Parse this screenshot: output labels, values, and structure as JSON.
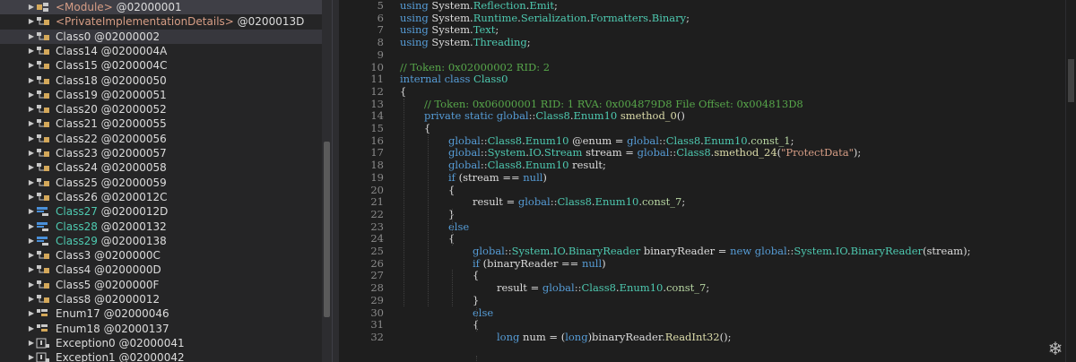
{
  "tree": {
    "items": [
      {
        "name": "<Module>",
        "token": "@02000001",
        "icon": "module-icon",
        "color": "mod",
        "state": "sel"
      },
      {
        "name": "<PrivateImplementationDetails>",
        "token": "@0200013D",
        "icon": "class-icon",
        "color": "mod",
        "state": ""
      },
      {
        "name": "Class0",
        "token": "@02000002",
        "icon": "class-icon",
        "color": "cls",
        "state": "sel2"
      },
      {
        "name": "Class14",
        "token": "@0200004A",
        "icon": "class-icon",
        "color": "cls",
        "state": ""
      },
      {
        "name": "Class15",
        "token": "@0200004C",
        "icon": "class-icon",
        "color": "cls",
        "state": ""
      },
      {
        "name": "Class18",
        "token": "@02000050",
        "icon": "class-icon",
        "color": "cls",
        "state": ""
      },
      {
        "name": "Class19",
        "token": "@02000051",
        "icon": "class-icon",
        "color": "cls",
        "state": ""
      },
      {
        "name": "Class20",
        "token": "@02000052",
        "icon": "class-icon",
        "color": "cls",
        "state": ""
      },
      {
        "name": "Class21",
        "token": "@02000055",
        "icon": "class-icon",
        "color": "cls",
        "state": ""
      },
      {
        "name": "Class22",
        "token": "@02000056",
        "icon": "class-icon",
        "color": "cls",
        "state": ""
      },
      {
        "name": "Class23",
        "token": "@02000057",
        "icon": "class-icon",
        "color": "cls",
        "state": ""
      },
      {
        "name": "Class24",
        "token": "@02000058",
        "icon": "class-icon",
        "color": "cls",
        "state": ""
      },
      {
        "name": "Class25",
        "token": "@02000059",
        "icon": "class-icon",
        "color": "cls",
        "state": ""
      },
      {
        "name": "Class26",
        "token": "@0200012C",
        "icon": "class-icon",
        "color": "cls",
        "state": ""
      },
      {
        "name": "Class27",
        "token": "@0200012D",
        "icon": "enum-blue-icon",
        "color": "grn",
        "state": ""
      },
      {
        "name": "Class28",
        "token": "@02000132",
        "icon": "enum-blue-icon",
        "color": "grn",
        "state": ""
      },
      {
        "name": "Class29",
        "token": "@02000138",
        "icon": "enum-blue-icon",
        "color": "grn",
        "state": ""
      },
      {
        "name": "Class3",
        "token": "@0200000C",
        "icon": "class-icon",
        "color": "cls",
        "state": ""
      },
      {
        "name": "Class4",
        "token": "@0200000D",
        "icon": "class-icon",
        "color": "cls",
        "state": ""
      },
      {
        "name": "Class5",
        "token": "@0200000F",
        "icon": "class-icon",
        "color": "cls",
        "state": ""
      },
      {
        "name": "Class8",
        "token": "@02000012",
        "icon": "class-icon",
        "color": "cls",
        "state": ""
      },
      {
        "name": "Enum17",
        "token": "@02000046",
        "icon": "enum-icon",
        "color": "enu",
        "state": ""
      },
      {
        "name": "Enum18",
        "token": "@02000137",
        "icon": "enum-icon",
        "color": "enu",
        "state": ""
      },
      {
        "name": "Exception0",
        "token": "@02000041",
        "icon": "exception-icon",
        "color": "cls",
        "state": ""
      },
      {
        "name": "Exception1",
        "token": "@02000042",
        "icon": "exception-icon",
        "color": "cls",
        "state": ""
      }
    ]
  },
  "editor": {
    "lines": [
      {
        "n": "5",
        "indent": 0,
        "parts": [
          [
            "k",
            "using "
          ],
          [
            "",
            "System."
          ],
          [
            "t",
            "Reflection"
          ],
          [
            "",
            "."
          ],
          [
            "t",
            "Emit"
          ],
          [
            "",
            ";"
          ]
        ]
      },
      {
        "n": "6",
        "indent": 0,
        "parts": [
          [
            "k",
            "using "
          ],
          [
            "",
            "System."
          ],
          [
            "t",
            "Runtime"
          ],
          [
            "",
            "."
          ],
          [
            "t",
            "Serialization"
          ],
          [
            "",
            "."
          ],
          [
            "t",
            "Formatters"
          ],
          [
            "",
            "."
          ],
          [
            "t",
            "Binary"
          ],
          [
            "",
            ";"
          ]
        ]
      },
      {
        "n": "7",
        "indent": 0,
        "parts": [
          [
            "k",
            "using "
          ],
          [
            "",
            "System."
          ],
          [
            "t",
            "Text"
          ],
          [
            "",
            ";"
          ]
        ]
      },
      {
        "n": "8",
        "indent": 0,
        "parts": [
          [
            "k",
            "using "
          ],
          [
            "",
            "System."
          ],
          [
            "t",
            "Threading"
          ],
          [
            "",
            ";"
          ]
        ]
      },
      {
        "n": "9",
        "indent": 0,
        "parts": []
      },
      {
        "n": "10",
        "indent": 0,
        "parts": [
          [
            "c",
            "// Token: 0x02000002 RID: 2"
          ]
        ]
      },
      {
        "n": "11",
        "indent": 0,
        "parts": [
          [
            "k",
            "internal class "
          ],
          [
            "t",
            "Class0"
          ]
        ]
      },
      {
        "n": "12",
        "indent": 0,
        "parts": [
          [
            "",
            "{"
          ]
        ]
      },
      {
        "n": "13",
        "indent": 1,
        "parts": [
          [
            "c",
            "// Token: 0x06000001 RID: 1 RVA: 0x004879D8 File Offset: 0x004813D8"
          ]
        ]
      },
      {
        "n": "14",
        "indent": 1,
        "parts": [
          [
            "k",
            "private static global"
          ],
          [
            "g",
            "::"
          ],
          [
            "t",
            "Class8"
          ],
          [
            "",
            "."
          ],
          [
            "t",
            "Enum10 "
          ],
          [
            "m",
            "smethod_0"
          ],
          [
            "",
            "()"
          ]
        ]
      },
      {
        "n": "15",
        "indent": 1,
        "parts": [
          [
            "",
            "{"
          ]
        ]
      },
      {
        "n": "16",
        "indent": 2,
        "parts": [
          [
            "k",
            "global"
          ],
          [
            "g",
            "::"
          ],
          [
            "t",
            "Class8"
          ],
          [
            "",
            "."
          ],
          [
            "t",
            "Enum10 "
          ],
          [
            "",
            "@enum = "
          ],
          [
            "k",
            "global"
          ],
          [
            "g",
            "::"
          ],
          [
            "t",
            "Class8"
          ],
          [
            "",
            "."
          ],
          [
            "t",
            "Enum10"
          ],
          [
            "",
            "."
          ],
          [
            "f",
            "const_1"
          ],
          [
            "",
            ";"
          ]
        ]
      },
      {
        "n": "17",
        "indent": 2,
        "parts": [
          [
            "k",
            "global"
          ],
          [
            "g",
            "::"
          ],
          [
            "t",
            "System"
          ],
          [
            "",
            "."
          ],
          [
            "t",
            "IO"
          ],
          [
            "",
            "."
          ],
          [
            "t",
            "Stream "
          ],
          [
            "",
            "stream = "
          ],
          [
            "k",
            "global"
          ],
          [
            "g",
            "::"
          ],
          [
            "t",
            "Class8"
          ],
          [
            "",
            "."
          ],
          [
            "m",
            "smethod_24"
          ],
          [
            "",
            "("
          ],
          [
            "s",
            "\"ProtectData\""
          ],
          [
            "",
            ");"
          ]
        ]
      },
      {
        "n": "18",
        "indent": 2,
        "parts": [
          [
            "k",
            "global"
          ],
          [
            "g",
            "::"
          ],
          [
            "t",
            "Class8"
          ],
          [
            "",
            "."
          ],
          [
            "t",
            "Enum10 "
          ],
          [
            "",
            "result;"
          ]
        ]
      },
      {
        "n": "19",
        "indent": 2,
        "parts": [
          [
            "k",
            "if "
          ],
          [
            "",
            "(stream == "
          ],
          [
            "k",
            "null"
          ],
          [
            "",
            ")"
          ]
        ]
      },
      {
        "n": "20",
        "indent": 2,
        "parts": [
          [
            "",
            "{"
          ]
        ]
      },
      {
        "n": "21",
        "indent": 3,
        "parts": [
          [
            "",
            "result = "
          ],
          [
            "k",
            "global"
          ],
          [
            "g",
            "::"
          ],
          [
            "t",
            "Class8"
          ],
          [
            "",
            "."
          ],
          [
            "t",
            "Enum10"
          ],
          [
            "",
            "."
          ],
          [
            "f",
            "const_7"
          ],
          [
            "",
            ";"
          ]
        ]
      },
      {
        "n": "22",
        "indent": 2,
        "parts": [
          [
            "",
            "}"
          ]
        ]
      },
      {
        "n": "23",
        "indent": 2,
        "parts": [
          [
            "k",
            "else"
          ]
        ]
      },
      {
        "n": "24",
        "indent": 2,
        "parts": [
          [
            "",
            "{"
          ]
        ]
      },
      {
        "n": "25",
        "indent": 3,
        "parts": [
          [
            "k",
            "global"
          ],
          [
            "g",
            "::"
          ],
          [
            "t",
            "System"
          ],
          [
            "",
            "."
          ],
          [
            "t",
            "IO"
          ],
          [
            "",
            "."
          ],
          [
            "t",
            "BinaryReader "
          ],
          [
            "",
            "binaryReader = "
          ],
          [
            "k",
            "new global"
          ],
          [
            "g",
            "::"
          ],
          [
            "t",
            "System"
          ],
          [
            "",
            "."
          ],
          [
            "t",
            "IO"
          ],
          [
            "",
            "."
          ],
          [
            "t",
            "BinaryReader"
          ],
          [
            "",
            "(stream);"
          ]
        ]
      },
      {
        "n": "26",
        "indent": 3,
        "parts": [
          [
            "k",
            "if "
          ],
          [
            "",
            "(binaryReader == "
          ],
          [
            "k",
            "null"
          ],
          [
            "",
            ")"
          ]
        ]
      },
      {
        "n": "27",
        "indent": 3,
        "parts": [
          [
            "",
            "{"
          ]
        ]
      },
      {
        "n": "28",
        "indent": 4,
        "parts": [
          [
            "",
            "result = "
          ],
          [
            "k",
            "global"
          ],
          [
            "g",
            "::"
          ],
          [
            "t",
            "Class8"
          ],
          [
            "",
            "."
          ],
          [
            "t",
            "Enum10"
          ],
          [
            "",
            "."
          ],
          [
            "f",
            "const_7"
          ],
          [
            "",
            ";"
          ]
        ]
      },
      {
        "n": "29",
        "indent": 3,
        "parts": [
          [
            "",
            "}"
          ]
        ]
      },
      {
        "n": "30",
        "indent": 3,
        "parts": [
          [
            "k",
            "else"
          ]
        ]
      },
      {
        "n": "31",
        "indent": 3,
        "parts": [
          [
            "",
            "{"
          ]
        ]
      },
      {
        "n": "32",
        "indent": 4,
        "parts": [
          [
            "k",
            "long "
          ],
          [
            "",
            "num = ("
          ],
          [
            "k",
            "long"
          ],
          [
            "",
            ")binaryReader."
          ],
          [
            "m",
            "ReadInt32"
          ],
          [
            "",
            "();"
          ]
        ]
      }
    ]
  },
  "corner_icon": "snowflake-icon"
}
